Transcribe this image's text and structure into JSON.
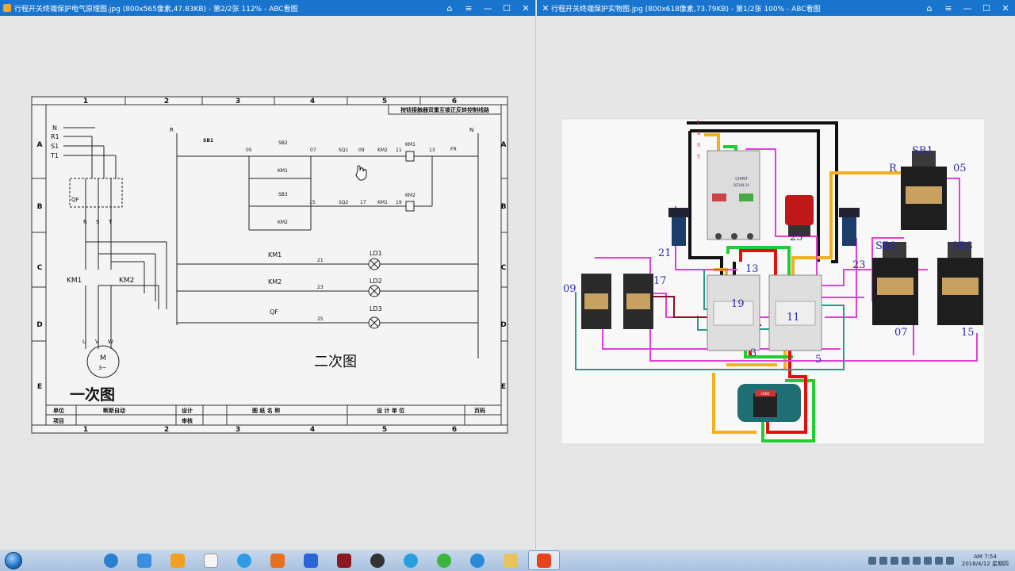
{
  "left_window": {
    "title": "行程开关终端保护电气原理图.jpg (800x565像素,47.83KB) - 第2/2张 112% - ABC看图",
    "controls": [
      "⌂",
      "≡",
      "—",
      "☐",
      "✕"
    ]
  },
  "right_window": {
    "title": "行程开关终端保护实物图.jpg (800x618像素,73.79KB) - 第1/2张 100% - ABC看图",
    "controls": [
      "⌂",
      "≡",
      "—",
      "☐",
      "✕"
    ]
  },
  "schematic": {
    "col_numbers": [
      "1",
      "2",
      "3",
      "4",
      "5",
      "6"
    ],
    "row_letters": [
      "A",
      "B",
      "C",
      "D",
      "E"
    ],
    "header_title": "按钮接触器双重互锁正反转控制线路",
    "supply_labels": [
      "N",
      "R1",
      "S1",
      "T1"
    ],
    "qf_label": "QF",
    "rst_labels": [
      "R",
      "S",
      "T"
    ],
    "km_labels": [
      "KM1",
      "KM2"
    ],
    "motor_label": "M",
    "motor_sub": "3~",
    "uvw": [
      "U",
      "V",
      "W"
    ],
    "r_label": "R",
    "n_label": "N",
    "ctrl_labels": {
      "sb1": "SB1",
      "w05": "05",
      "sb2": "SB2",
      "w07": "07",
      "sq1": "SQ1",
      "w09": "09",
      "km2_a": "KM2",
      "w11": "11",
      "km1_coil": "KM1",
      "w13": "13",
      "fr": "FR",
      "km1_aux": "KM1",
      "sb3": "SB3",
      "w15": "15",
      "sq2": "SQ2",
      "w17": "17",
      "km1_b": "KM1",
      "w19": "19",
      "km2_coil": "KM2",
      "km2_aux": "KM2"
    },
    "lamp_rows": [
      {
        "contact": "KM1",
        "wire": "21",
        "lamp": "LD1"
      },
      {
        "contact": "KM2",
        "wire": "23",
        "lamp": "LD2"
      },
      {
        "contact": "QF",
        "wire": "25",
        "lamp": "LD3"
      }
    ],
    "secondary_label": "二次图",
    "primary_label": "一次图",
    "table": {
      "unit": "单位",
      "name": "断斯自动",
      "design": "设计",
      "drawing": "图 纸 名 称",
      "design_unit": "设 计 单 位",
      "page": "页码",
      "project": "项目",
      "review": "审核"
    }
  },
  "photo": {
    "labels": {
      "sb1": "SB1",
      "r": "R",
      "w05": "05",
      "sb2": "SB2",
      "sb3": "SB3",
      "w21": "21",
      "w25": "25",
      "w23": "23",
      "w09": "09",
      "w17": "17",
      "w13": "13",
      "w19": "19",
      "w11": "11",
      "w07": "07",
      "w15": "15",
      "w3": "3",
      "w5": "5",
      "l1": "L",
      "l2": "R",
      "l3": "S",
      "l4": "T"
    },
    "breaker_brand": "CHINT",
    "breaker_model": "DZ108-20",
    "motor_brand": "CEKO"
  },
  "taskbar": {
    "clock_time": "AM 7:54",
    "clock_date": "2018/4/12 星期四"
  },
  "colors": {
    "title_bar": "#1874cd",
    "wire_black": "#111111",
    "wire_yellow": "#f2b01e",
    "wire_green": "#22cc33",
    "wire_red": "#e01010",
    "wire_magenta": "#e040d8",
    "wire_teal": "#2a9a8a",
    "wire_darkred": "#8a1020"
  }
}
